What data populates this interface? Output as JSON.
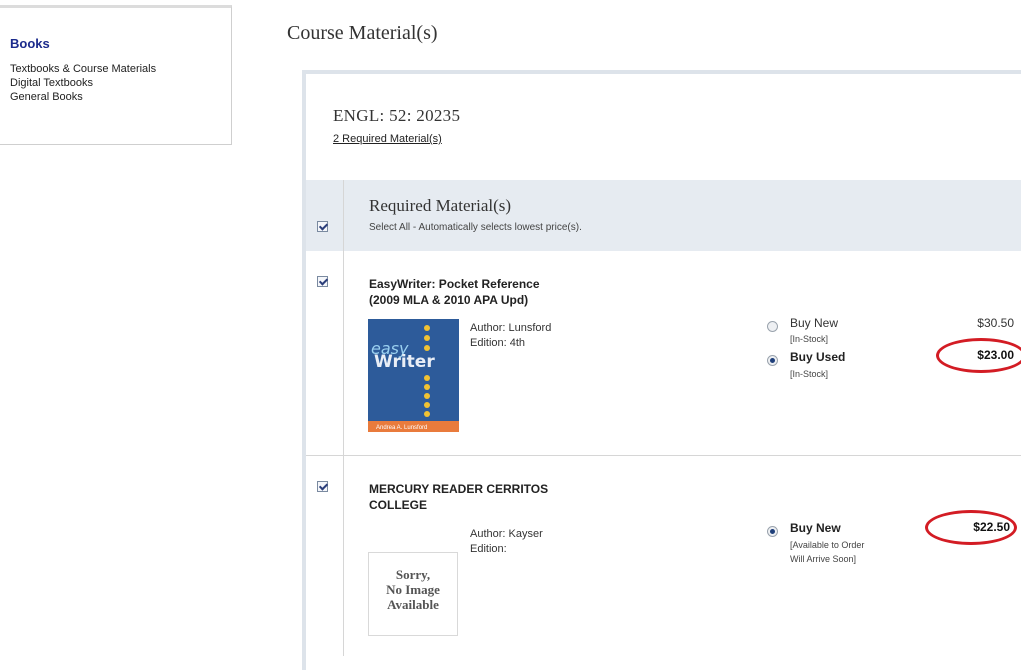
{
  "sidebar": {
    "heading": "Books",
    "links": [
      "Textbooks & Course Materials",
      "Digital Textbooks",
      "General Books"
    ]
  },
  "page_title": "Course Material(s)",
  "course": {
    "code": "ENGL:  52:  20235",
    "required_link": "2 Required Material(s)"
  },
  "required": {
    "title": "Required Material(s)",
    "select_all": "Select All - Automatically selects lowest price(s)."
  },
  "items": [
    {
      "title_line1": "EasyWriter: Pocket Reference",
      "title_line2": "(2009 MLA & 2010 APA Upd)",
      "author": "Author: Lunsford",
      "edition": "Edition: 4th",
      "cover_text1": "easy",
      "cover_text2": "Writer",
      "cover_author": "Andrea A. Lunsford",
      "options": [
        {
          "label": "Buy New",
          "stock": "[In-Stock]",
          "price": "$30.50",
          "selected": false
        },
        {
          "label": "Buy Used",
          "stock": "[In-Stock]",
          "price": "$23.00",
          "selected": true
        }
      ]
    },
    {
      "title_line1": "MERCURY READER CERRITOS",
      "title_line2": "COLLEGE",
      "author": "Author: Kayser",
      "edition": "Edition:",
      "no_image_1": "Sorry,",
      "no_image_2": "No Image",
      "no_image_3": "Available",
      "options": [
        {
          "label": "Buy New",
          "stock1": "[Available to Order",
          "stock2": "Will Arrive Soon]",
          "price": "$22.50",
          "selected": true
        }
      ]
    }
  ],
  "colors": {
    "highlight_ring": "#d31c24",
    "heading_blue": "#1b2a8c",
    "band": "#e6ebf1"
  }
}
